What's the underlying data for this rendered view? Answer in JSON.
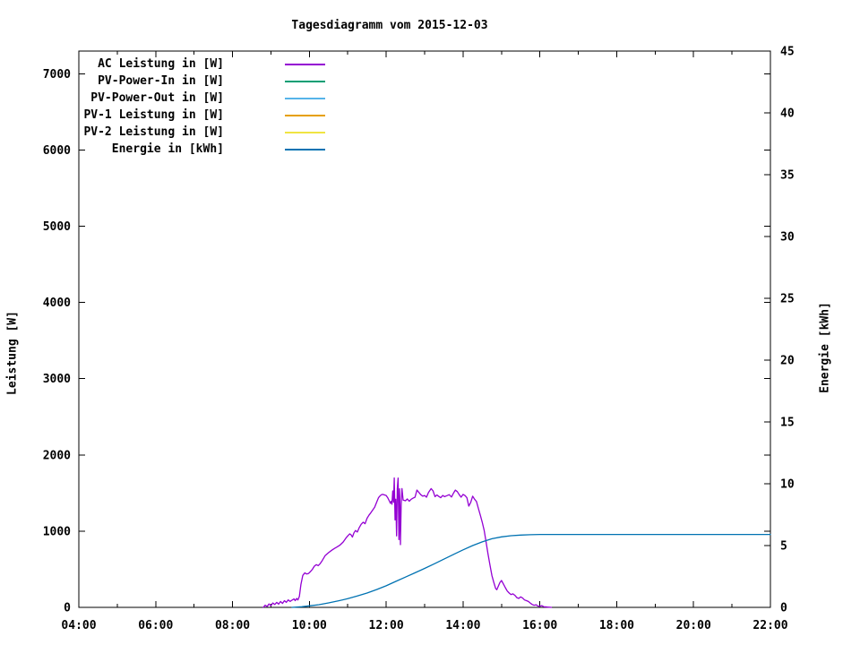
{
  "title": "Tagesdiagramm vom 2015-12-03",
  "axes": {
    "x": {
      "major_ticks": [
        {
          "t": 4,
          "label": "04:00"
        },
        {
          "t": 6,
          "label": "06:00"
        },
        {
          "t": 8,
          "label": "08:00"
        },
        {
          "t": 10,
          "label": "10:00"
        },
        {
          "t": 12,
          "label": "12:00"
        },
        {
          "t": 14,
          "label": "14:00"
        },
        {
          "t": 16,
          "label": "16:00"
        },
        {
          "t": 18,
          "label": "18:00"
        },
        {
          "t": 20,
          "label": "20:00"
        },
        {
          "t": 22,
          "label": "22:00"
        }
      ],
      "minor_ticks": [
        5,
        7,
        9,
        11,
        13,
        15,
        17,
        19,
        21
      ]
    },
    "y1": {
      "label": "Leistung [W]",
      "ticks": [
        {
          "v": 0,
          "label": "0"
        },
        {
          "v": 1000,
          "label": "1000"
        },
        {
          "v": 2000,
          "label": "2000"
        },
        {
          "v": 3000,
          "label": "3000"
        },
        {
          "v": 4000,
          "label": "4000"
        },
        {
          "v": 5000,
          "label": "5000"
        },
        {
          "v": 6000,
          "label": "6000"
        },
        {
          "v": 7000,
          "label": "7000"
        }
      ]
    },
    "y2": {
      "label": "Energie [kWh]",
      "ticks": [
        {
          "v": 0,
          "label": "0"
        },
        {
          "v": 5,
          "label": "5"
        },
        {
          "v": 10,
          "label": "10"
        },
        {
          "v": 15,
          "label": "15"
        },
        {
          "v": 20,
          "label": "20"
        },
        {
          "v": 25,
          "label": "25"
        },
        {
          "v": 30,
          "label": "30"
        },
        {
          "v": 35,
          "label": "35"
        },
        {
          "v": 40,
          "label": "40"
        },
        {
          "v": 45,
          "label": "45"
        }
      ]
    }
  },
  "legend": {
    "entries": [
      {
        "label": "AC Leistung in [W]",
        "color": "#9400d3"
      },
      {
        "label": "PV-Power-In in [W]",
        "color": "#009e73"
      },
      {
        "label": "PV-Power-Out in [W]",
        "color": "#56b4e9"
      },
      {
        "label": "PV-1 Leistung in [W]",
        "color": "#e69f00"
      },
      {
        "label": "PV-2 Leistung in [W]",
        "color": "#f0e442"
      },
      {
        "label": "Energie in [kWh]",
        "color": "#0072b2"
      }
    ]
  },
  "chart_data": {
    "type": "line",
    "title": "Tagesdiagramm vom 2015-12-03",
    "xlabel": "",
    "ylabel": "Leistung [W]",
    "y2label": "Energie [kWh]",
    "x_unit": "hour_of_day",
    "xlim": [
      4,
      22
    ],
    "ylim": [
      0,
      7297
    ],
    "y2lim": [
      0,
      45
    ],
    "grid": false,
    "legend_position": "top-left-inside",
    "series": [
      {
        "name": "AC Leistung in [W]",
        "color": "#9400d3",
        "axis": "y1",
        "points": [
          [
            8.8,
            0
          ],
          [
            8.85,
            28
          ],
          [
            8.9,
            12
          ],
          [
            8.95,
            45
          ],
          [
            9.0,
            22
          ],
          [
            9.05,
            58
          ],
          [
            9.1,
            38
          ],
          [
            9.15,
            66
          ],
          [
            9.2,
            42
          ],
          [
            9.25,
            78
          ],
          [
            9.3,
            52
          ],
          [
            9.35,
            88
          ],
          [
            9.4,
            66
          ],
          [
            9.45,
            98
          ],
          [
            9.5,
            78
          ],
          [
            9.55,
            95
          ],
          [
            9.6,
            112
          ],
          [
            9.63,
            88
          ],
          [
            9.67,
            118
          ],
          [
            9.7,
            98
          ],
          [
            9.74,
            145
          ],
          [
            9.78,
            300
          ],
          [
            9.83,
            420
          ],
          [
            9.88,
            452
          ],
          [
            9.93,
            438
          ],
          [
            9.98,
            445
          ],
          [
            10.03,
            470
          ],
          [
            10.08,
            500
          ],
          [
            10.13,
            540
          ],
          [
            10.18,
            560
          ],
          [
            10.23,
            548
          ],
          [
            10.28,
            572
          ],
          [
            10.33,
            610
          ],
          [
            10.41,
            678
          ],
          [
            10.5,
            718
          ],
          [
            10.58,
            748
          ],
          [
            10.65,
            772
          ],
          [
            10.72,
            792
          ],
          [
            10.8,
            818
          ],
          [
            10.88,
            858
          ],
          [
            10.95,
            908
          ],
          [
            11.0,
            938
          ],
          [
            11.05,
            965
          ],
          [
            11.09,
            948
          ],
          [
            11.12,
            922
          ],
          [
            11.16,
            978
          ],
          [
            11.2,
            1008
          ],
          [
            11.25,
            988
          ],
          [
            11.3,
            1048
          ],
          [
            11.35,
            1090
          ],
          [
            11.4,
            1118
          ],
          [
            11.45,
            1098
          ],
          [
            11.5,
            1168
          ],
          [
            11.55,
            1208
          ],
          [
            11.6,
            1242
          ],
          [
            11.65,
            1278
          ],
          [
            11.7,
            1312
          ],
          [
            11.75,
            1378
          ],
          [
            11.8,
            1438
          ],
          [
            11.85,
            1468
          ],
          [
            11.89,
            1482
          ],
          [
            11.94,
            1478
          ],
          [
            12.0,
            1468
          ],
          [
            12.04,
            1438
          ],
          [
            12.08,
            1398
          ],
          [
            12.11,
            1365
          ],
          [
            12.13,
            1392
          ],
          [
            12.15,
            1352
          ],
          [
            12.17,
            1528
          ],
          [
            12.19,
            1378
          ],
          [
            12.21,
            1698
          ],
          [
            12.23,
            1148
          ],
          [
            12.25,
            1418
          ],
          [
            12.27,
            938
          ],
          [
            12.29,
            1558
          ],
          [
            12.31,
            1695
          ],
          [
            12.33,
            888
          ],
          [
            12.35,
            1555
          ],
          [
            12.37,
            822
          ],
          [
            12.39,
            1338
          ],
          [
            12.41,
            1558
          ],
          [
            12.44,
            1408
          ],
          [
            12.5,
            1398
          ],
          [
            12.55,
            1422
          ],
          [
            12.6,
            1392
          ],
          [
            12.65,
            1418
          ],
          [
            12.7,
            1432
          ],
          [
            12.75,
            1445
          ],
          [
            12.8,
            1538
          ],
          [
            12.85,
            1508
          ],
          [
            12.9,
            1478
          ],
          [
            12.95,
            1458
          ],
          [
            13.0,
            1468
          ],
          [
            13.05,
            1445
          ],
          [
            13.1,
            1508
          ],
          [
            13.17,
            1558
          ],
          [
            13.22,
            1528
          ],
          [
            13.27,
            1452
          ],
          [
            13.32,
            1475
          ],
          [
            13.37,
            1455
          ],
          [
            13.42,
            1438
          ],
          [
            13.47,
            1468
          ],
          [
            13.52,
            1452
          ],
          [
            13.58,
            1465
          ],
          [
            13.64,
            1478
          ],
          [
            13.7,
            1448
          ],
          [
            13.75,
            1498
          ],
          [
            13.8,
            1538
          ],
          [
            13.85,
            1518
          ],
          [
            13.9,
            1478
          ],
          [
            13.95,
            1445
          ],
          [
            14.0,
            1482
          ],
          [
            14.05,
            1468
          ],
          [
            14.1,
            1438
          ],
          [
            14.15,
            1328
          ],
          [
            14.2,
            1378
          ],
          [
            14.25,
            1458
          ],
          [
            14.3,
            1418
          ],
          [
            14.35,
            1388
          ],
          [
            14.4,
            1298
          ],
          [
            14.45,
            1208
          ],
          [
            14.5,
            1118
          ],
          [
            14.55,
            1008
          ],
          [
            14.6,
            858
          ],
          [
            14.65,
            698
          ],
          [
            14.7,
            558
          ],
          [
            14.75,
            418
          ],
          [
            14.8,
            328
          ],
          [
            14.85,
            248
          ],
          [
            14.88,
            232
          ],
          [
            14.92,
            278
          ],
          [
            14.96,
            328
          ],
          [
            15.0,
            352
          ],
          [
            15.05,
            308
          ],
          [
            15.1,
            258
          ],
          [
            15.15,
            215
          ],
          [
            15.2,
            188
          ],
          [
            15.25,
            168
          ],
          [
            15.3,
            178
          ],
          [
            15.35,
            158
          ],
          [
            15.4,
            128
          ],
          [
            15.45,
            118
          ],
          [
            15.5,
            138
          ],
          [
            15.55,
            122
          ],
          [
            15.6,
            98
          ],
          [
            15.65,
            88
          ],
          [
            15.7,
            78
          ],
          [
            15.75,
            58
          ],
          [
            15.8,
            38
          ],
          [
            15.85,
            28
          ],
          [
            15.9,
            34
          ],
          [
            15.95,
            18
          ],
          [
            16.0,
            14
          ],
          [
            16.05,
            24
          ],
          [
            16.1,
            8
          ],
          [
            16.2,
            4
          ],
          [
            16.3,
            0
          ]
        ]
      },
      {
        "name": "PV-Power-In in [W]",
        "color": "#009e73",
        "axis": "y1",
        "points": []
      },
      {
        "name": "PV-Power-Out in [W]",
        "color": "#56b4e9",
        "axis": "y1",
        "points": []
      },
      {
        "name": "PV-1 Leistung in [W]",
        "color": "#e69f00",
        "axis": "y1",
        "points": []
      },
      {
        "name": "PV-2 Leistung in [W]",
        "color": "#f0e442",
        "axis": "y1",
        "points": []
      },
      {
        "name": "Energie in [kWh]",
        "color": "#0072b2",
        "axis": "y2",
        "points": [
          [
            9.55,
            0
          ],
          [
            9.8,
            0.05
          ],
          [
            10.0,
            0.12
          ],
          [
            10.25,
            0.22
          ],
          [
            10.5,
            0.36
          ],
          [
            10.75,
            0.52
          ],
          [
            11.0,
            0.7
          ],
          [
            11.25,
            0.92
          ],
          [
            11.5,
            1.16
          ],
          [
            11.75,
            1.44
          ],
          [
            12.0,
            1.75
          ],
          [
            12.25,
            2.1
          ],
          [
            12.5,
            2.45
          ],
          [
            12.75,
            2.8
          ],
          [
            13.0,
            3.15
          ],
          [
            13.25,
            3.52
          ],
          [
            13.5,
            3.9
          ],
          [
            13.75,
            4.28
          ],
          [
            14.0,
            4.65
          ],
          [
            14.25,
            5.0
          ],
          [
            14.5,
            5.3
          ],
          [
            14.75,
            5.55
          ],
          [
            15.0,
            5.7
          ],
          [
            15.25,
            5.8
          ],
          [
            15.5,
            5.85
          ],
          [
            15.75,
            5.88
          ],
          [
            16.0,
            5.9
          ],
          [
            17.0,
            5.9
          ],
          [
            18.0,
            5.9
          ],
          [
            19.0,
            5.9
          ],
          [
            20.0,
            5.9
          ],
          [
            21.0,
            5.9
          ],
          [
            22.0,
            5.9
          ]
        ]
      }
    ]
  }
}
